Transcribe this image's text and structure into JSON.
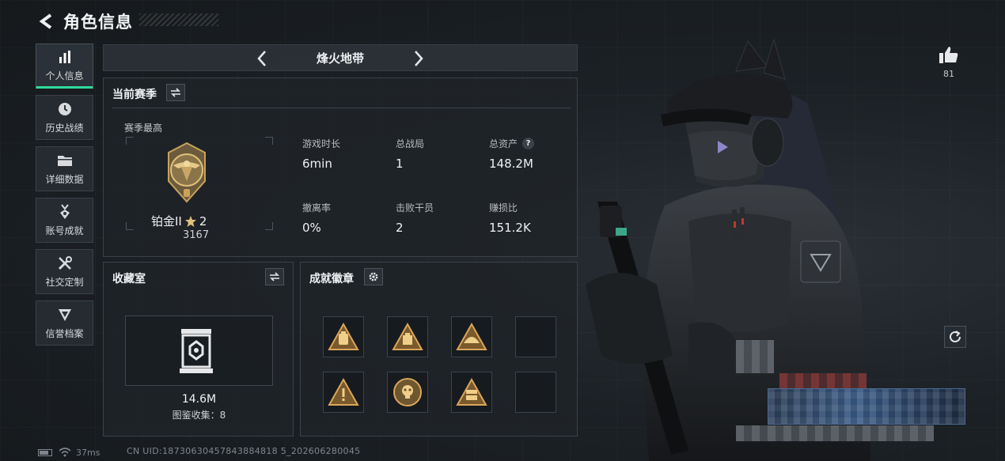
{
  "header": {
    "title": "角色信息"
  },
  "sidebar": {
    "items": [
      {
        "label": "个人信息",
        "icon": "bar-chart-icon",
        "active": true
      },
      {
        "label": "历史战绩",
        "icon": "clock-icon",
        "active": false
      },
      {
        "label": "详细数据",
        "icon": "folder-icon",
        "active": false
      },
      {
        "label": "账号成就",
        "icon": "medal-icon",
        "active": false
      },
      {
        "label": "社交定制",
        "icon": "tools-icon",
        "active": false
      },
      {
        "label": "信誉档案",
        "icon": "shield-icon",
        "active": false
      }
    ]
  },
  "mode": {
    "title": "烽火地带"
  },
  "season": {
    "title": "当前赛季",
    "subtitle": "赛季最高",
    "rank_name": "铂金II",
    "rank_stars": "2",
    "rank_score": "3167",
    "stats": [
      {
        "label": "游戏时长",
        "value": "6min"
      },
      {
        "label": "总战局",
        "value": "1"
      },
      {
        "label": "总资产",
        "value": "148.2M",
        "help": "?"
      },
      {
        "label": "撤离率",
        "value": "0%"
      },
      {
        "label": "击败干员",
        "value": "2"
      },
      {
        "label": "赚损比",
        "value": "151.2K"
      }
    ]
  },
  "collection": {
    "title": "收藏室",
    "value": "14.6M",
    "count_text": "图鉴收集：8"
  },
  "badges": {
    "title": "成就徽章",
    "slots": [
      {
        "icon": "bag-badge-icon",
        "filled": true
      },
      {
        "icon": "case-badge-icon",
        "filled": true
      },
      {
        "icon": "helmet-badge-icon",
        "filled": true
      },
      {
        "icon": "empty-slot",
        "filled": false
      },
      {
        "icon": "warning-badge-icon",
        "filled": true
      },
      {
        "icon": "skull-badge-icon",
        "filled": true
      },
      {
        "icon": "crate-badge-icon",
        "filled": true
      },
      {
        "icon": "empty-slot",
        "filled": false
      }
    ]
  },
  "social": {
    "like_count": "81"
  },
  "footer": {
    "ping": "37ms",
    "uid": "CN UID:18730630457843884818 5_202606280045"
  },
  "colors": {
    "accent": "#2fd99a",
    "gold": "#c9a35a",
    "panel": "#1e2328"
  }
}
